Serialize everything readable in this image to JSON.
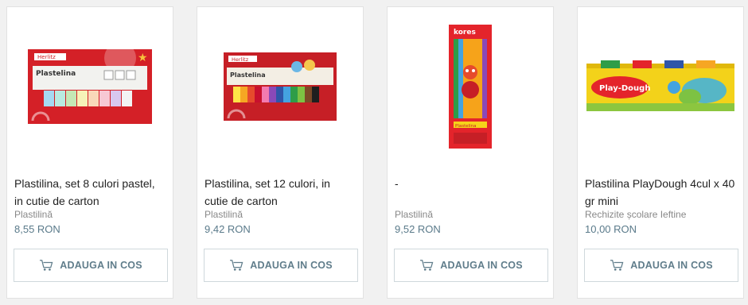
{
  "products": [
    {
      "title": "Plastilina, set 8 culori pastel, in cutie de carton",
      "category": "Plastilină",
      "price": "8,55 RON",
      "box_brand": "Herlitz",
      "box_label": "Plastelina",
      "button": "ADAUGA IN COS"
    },
    {
      "title": "Plastilina, set 12 culori, in cutie de carton",
      "category": "Plastilină",
      "price": "9,42 RON",
      "box_brand": "Herlitz",
      "box_label": "Plastelina",
      "button": "ADAUGA IN COS"
    },
    {
      "title": "-",
      "category": "Plastilină",
      "price": "9,52 RON",
      "box_brand": "kores",
      "box_label": "Plastelina",
      "button": "ADAUGA IN COS"
    },
    {
      "title": "Plastilina PlayDough 4cul x 40 gr mini",
      "category": "Rechizite școlare Ieftine",
      "price": "10,00 RON",
      "box_brand": "Play-Dough",
      "box_label": "Play-Dough",
      "button": "ADAUGA IN COS"
    }
  ],
  "colors": {
    "accent": "#607d8b",
    "price": "#5a7a8a",
    "box_red": "#d42027",
    "box_yellow": "#f3d21a"
  },
  "icons": [
    "cart-icon"
  ]
}
